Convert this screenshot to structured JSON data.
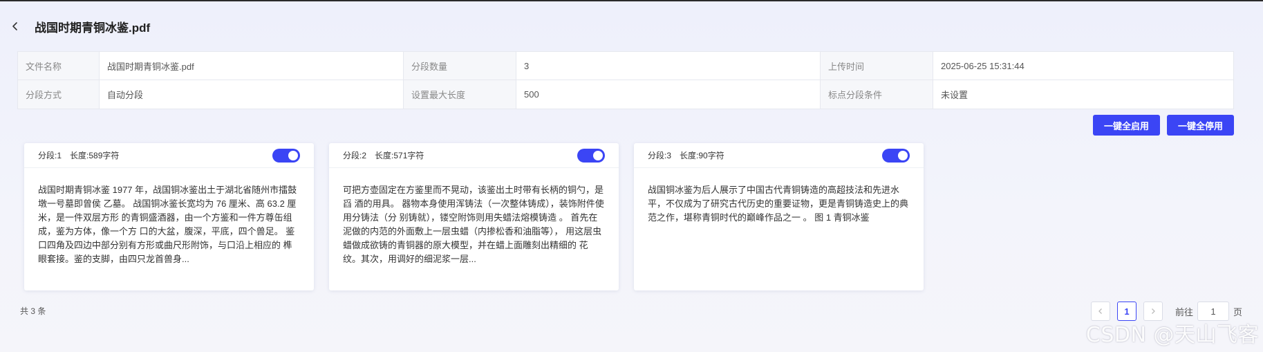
{
  "page": {
    "title": "战国时期青铜冰鉴.pdf"
  },
  "info": {
    "row1": [
      {
        "label": "文件名称",
        "value": "战国时期青铜冰鉴.pdf"
      },
      {
        "label": "分段数量",
        "value": "3"
      },
      {
        "label": "上传时间",
        "value": "2025-06-25 15:31:44"
      }
    ],
    "row2": [
      {
        "label": "分段方式",
        "value": "自动分段"
      },
      {
        "label": "设置最大长度",
        "value": "500"
      },
      {
        "label": "标点分段条件",
        "value": "未设置"
      }
    ]
  },
  "actions": {
    "enable_all": "一键全启用",
    "disable_all": "一键全停用"
  },
  "segments": [
    {
      "index": "分段:1",
      "length": "长度:589字符",
      "enabled": true,
      "text": "战国时期青铜冰鉴 1977 年，战国铜冰鉴出土于湖北省随州市擂鼓墩一号墓即曾侯 乙墓。 战国铜冰鉴长宽均为 76 厘米、高 63.2 厘米，是一件双层方形 的青铜盛酒器，由一个方鉴和一件方尊缶组成，鉴为方体，像一个方 口的大盆，腹深，平底，四个兽足。 鉴口四角及四边中部分别有方形或曲尺形附饰，与口沿上相应的 榫眼套接。鉴的支脚，由四只龙首兽身..."
    },
    {
      "index": "分段:2",
      "length": "长度:571字符",
      "enabled": true,
      "text": "可把方壶固定在方鉴里而不晃动，该鉴出土时带有长柄的铜勺，是舀 酒的用具。 器物本身使用浑铸法（一次整体铸成），装饰附件使用分铸法（分 别铸就），镂空附饰则用失蜡法熔模铸造 。 首先在泥做的内范的外面敷上一层虫蜡（内掺松香和油脂等）， 用这层虫蜡做成欲铸的青铜器的原大模型，并在蜡上面雕刻出精细的 花纹。其次，用调好的细泥浆一层..."
    },
    {
      "index": "分段:3",
      "length": "长度:90字符",
      "enabled": true,
      "text": "战国铜冰鉴为后人展示了中国古代青铜铸造的高超技法和先进水平，不仅成为了研究古代历史的重要证物，更是青铜铸造史上的典 范之作，堪称青铜时代的巅峰作品之一 。 图 1 青铜冰鉴"
    }
  ],
  "footer": {
    "total": "共 3 条"
  },
  "pagination": {
    "current": "1",
    "goto_label": "前往",
    "goto_value": "1",
    "page_suffix": "页"
  },
  "watermark": "CSDN @天山飞客"
}
